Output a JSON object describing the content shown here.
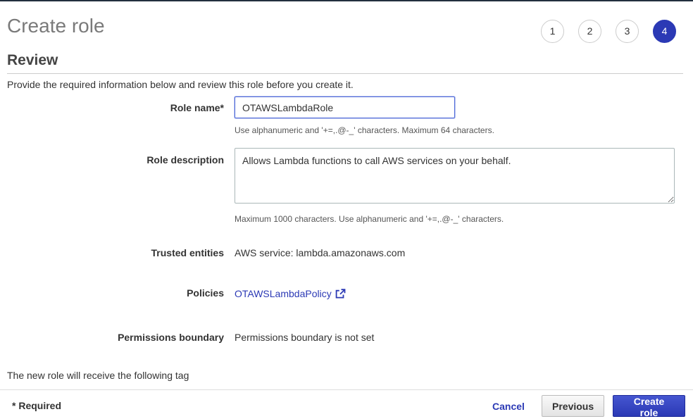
{
  "header": {
    "title": "Create role",
    "steps": [
      {
        "label": "1",
        "active": false
      },
      {
        "label": "2",
        "active": false
      },
      {
        "label": "3",
        "active": false
      },
      {
        "label": "4",
        "active": true
      }
    ]
  },
  "review": {
    "title": "Review",
    "intro": "Provide the required information below and review this role before you create it."
  },
  "form": {
    "role_name": {
      "label": "Role name*",
      "value": "OTAWSLambdaRole",
      "hint": "Use alphanumeric and '+=,.@-_' characters. Maximum 64 characters."
    },
    "role_description": {
      "label": "Role description",
      "value": "Allows Lambda functions to call AWS services on your behalf.",
      "hint": "Maximum 1000 characters. Use alphanumeric and '+=,.@-_' characters."
    },
    "trusted_entities": {
      "label": "Trusted entities",
      "value": "AWS service: lambda.amazonaws.com"
    },
    "policies": {
      "label": "Policies",
      "link_text": "OTAWSLambdaPolicy",
      "icon": "external-link-icon"
    },
    "permissions_boundary": {
      "label": "Permissions boundary",
      "value": "Permissions boundary is not set"
    },
    "tag_note": "The new role will receive the following tag"
  },
  "footer": {
    "required_note": "* Required",
    "cancel_label": "Cancel",
    "previous_label": "Previous",
    "create_label": "Create role"
  },
  "colors": {
    "accent": "#2b39b5",
    "link": "#2b39b5",
    "input_focus_border": "#4d68d8"
  }
}
